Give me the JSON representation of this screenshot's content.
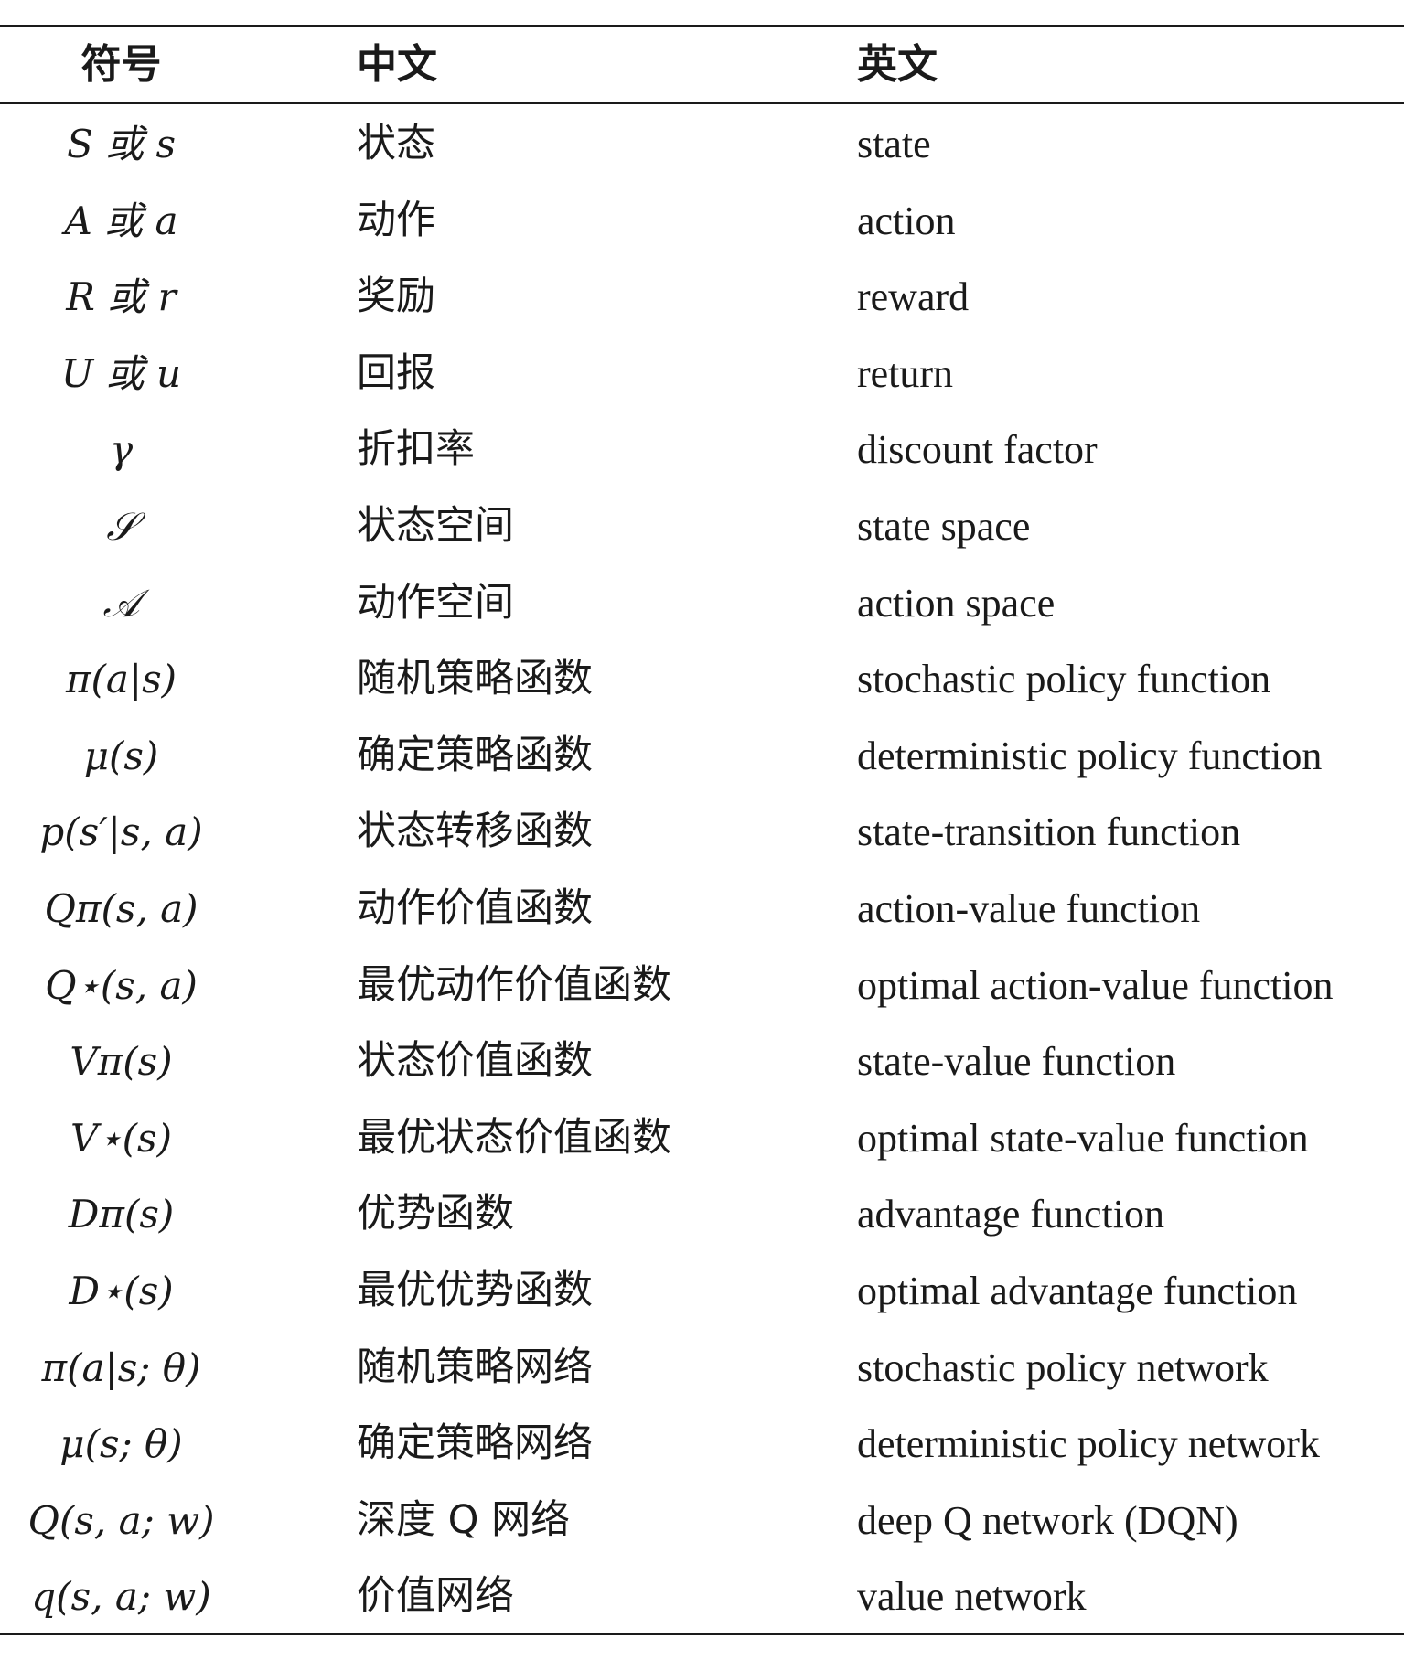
{
  "table": {
    "headers": {
      "symbol": "符号",
      "chinese": "中文",
      "english": "英文"
    },
    "rows": [
      {
        "symbol": "S 或 s",
        "chinese": "状态",
        "english": "state"
      },
      {
        "symbol": "A 或 a",
        "chinese": "动作",
        "english": "action"
      },
      {
        "symbol": "R 或 r",
        "chinese": "奖励",
        "english": "reward"
      },
      {
        "symbol": "U 或 u",
        "chinese": "回报",
        "english": "return"
      },
      {
        "symbol": "γ",
        "chinese": "折扣率",
        "english": "discount factor"
      },
      {
        "symbol": "𝒮",
        "chinese": "状态空间",
        "english": "state space"
      },
      {
        "symbol": "𝒜",
        "chinese": "动作空间",
        "english": "action space"
      },
      {
        "symbol": "π(a|s)",
        "chinese": "随机策略函数",
        "english": "stochastic policy function"
      },
      {
        "symbol": "μ(s)",
        "chinese": "确定策略函数",
        "english": "deterministic policy function"
      },
      {
        "symbol": "p(s′|s, a)",
        "chinese": "状态转移函数",
        "english": "state-transition function"
      },
      {
        "symbol": "Qπ(s, a)",
        "chinese": "动作价值函数",
        "english": "action-value function"
      },
      {
        "symbol": "Q⋆(s, a)",
        "chinese": "最优动作价值函数",
        "english": "optimal action-value function"
      },
      {
        "symbol": "Vπ(s)",
        "chinese": "状态价值函数",
        "english": "state-value function"
      },
      {
        "symbol": "V⋆(s)",
        "chinese": "最优状态价值函数",
        "english": "optimal state-value function"
      },
      {
        "symbol": "Dπ(s)",
        "chinese": "优势函数",
        "english": "advantage function"
      },
      {
        "symbol": "D⋆(s)",
        "chinese": "最优优势函数",
        "english": "optimal advantage function"
      },
      {
        "symbol": "π(a|s; θ)",
        "chinese": "随机策略网络",
        "english": "stochastic policy network"
      },
      {
        "symbol": "μ(s; θ)",
        "chinese": "确定策略网络",
        "english": "deterministic policy network"
      },
      {
        "symbol": "Q(s, a; w)",
        "chinese": "深度 Q 网络",
        "english": "deep Q network (DQN)"
      },
      {
        "symbol": "q(s, a; w)",
        "chinese": "价值网络",
        "english": "value network"
      }
    ]
  }
}
